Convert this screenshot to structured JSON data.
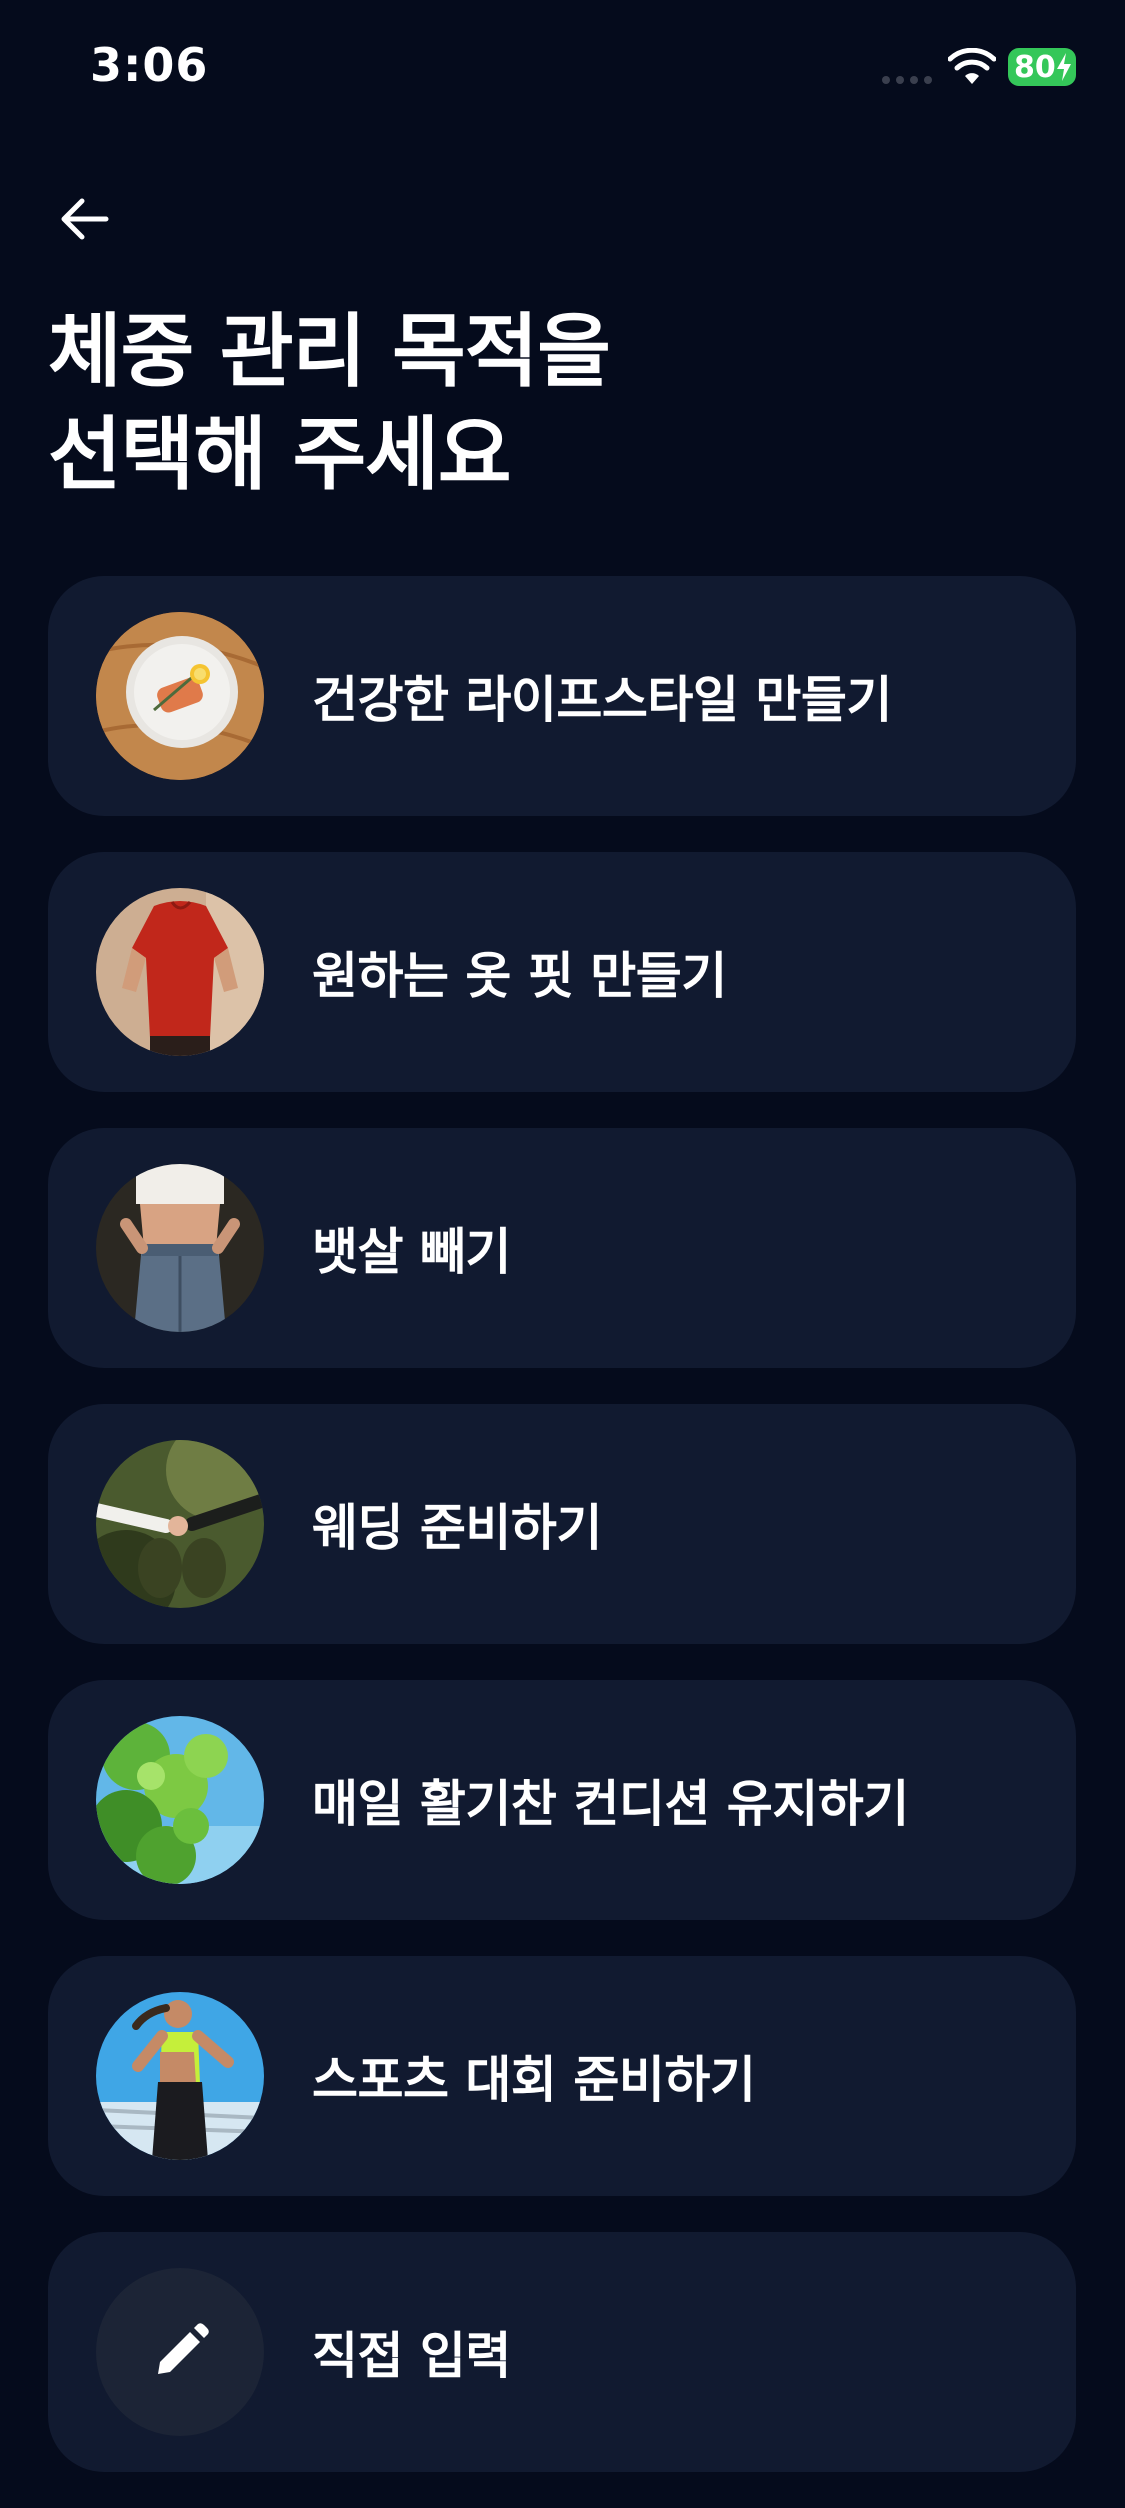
{
  "status_bar": {
    "time": "3:06",
    "battery_level": "80"
  },
  "header": {
    "title": "체중 관리 목적을\n선택해 주세요"
  },
  "options": [
    {
      "label": "건강한 라이프스타일 만들기",
      "icon": "salmon-dish-photo"
    },
    {
      "label": "원하는 옷 핏 만들기",
      "icon": "red-tshirt-photo"
    },
    {
      "label": "뱃살 빼기",
      "icon": "waist-jeans-photo"
    },
    {
      "label": "웨딩 준비하기",
      "icon": "holding-hands-photo"
    },
    {
      "label": "매일 활기찬 컨디션 유지하기",
      "icon": "green-leaves-photo"
    },
    {
      "label": "스포츠 대회 준비하기",
      "icon": "runner-photo"
    },
    {
      "label": "직접 입력",
      "icon": "pencil-icon"
    }
  ],
  "colors": {
    "background": "#050B1C",
    "card": "#111A30",
    "battery": "#34C759"
  }
}
